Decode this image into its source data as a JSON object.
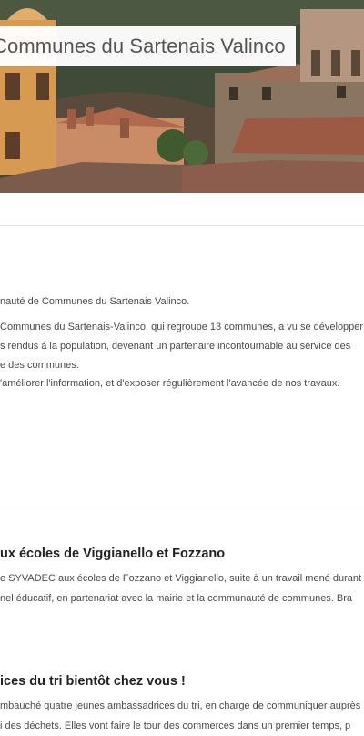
{
  "page": {
    "title": "Communes du Sartenais Valinco"
  },
  "intro": {
    "lines": [
      "nauté de Communes du Sartenais Valinco.",
      "Communes du Sartenais-Valinco, qui regroupe 13 communes, a vu se développer",
      "s rendus à la population, devenant un partenaire incontournable au service des",
      "e des communes.",
      "'améliorer l'information, et d'exposer régulièrement l'avancée de nos travaux."
    ]
  },
  "news": [
    {
      "title": "ux écoles de Viggianello et Fozzano",
      "lines": [
        "e SYVADEC aux écoles de Fozzano et Viggianello, suite à un travail mené durant",
        "nel éducatif, en partenariat avec la mairie et la communauté de communes. Bra"
      ]
    },
    {
      "title": "ices du tri bientôt chez vous !",
      "lines": [
        "mbauché quatre jeunes ambassadrices du tri, en charge de communiquer auprès",
        "i des déchets. Elles vont faire le tour des commerces dans un premier temps, p"
      ]
    }
  ]
}
